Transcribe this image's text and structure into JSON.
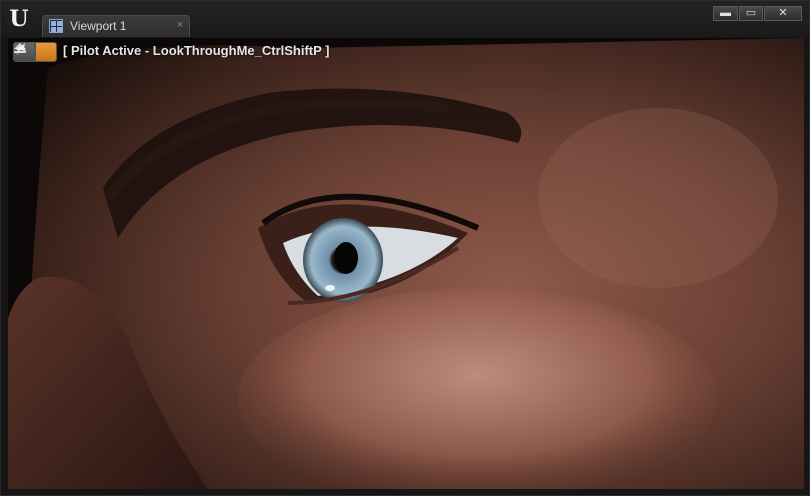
{
  "app": {
    "logo_glyph": "U"
  },
  "tab": {
    "label": "Viewport 1",
    "close_glyph": "×"
  },
  "window_controls": {
    "minimize": "▬",
    "maximize": "▭",
    "close": "✕"
  },
  "viewport": {
    "pilot_label": "[ Pilot Active - LookThroughMe_CtrlShiftP ]",
    "toolbar_icons": [
      "eject-icon",
      "pilot-actor-icon"
    ]
  },
  "colors": {
    "accent_orange": "#d9862a",
    "tab_icon_blue": "#8fb0e0"
  }
}
